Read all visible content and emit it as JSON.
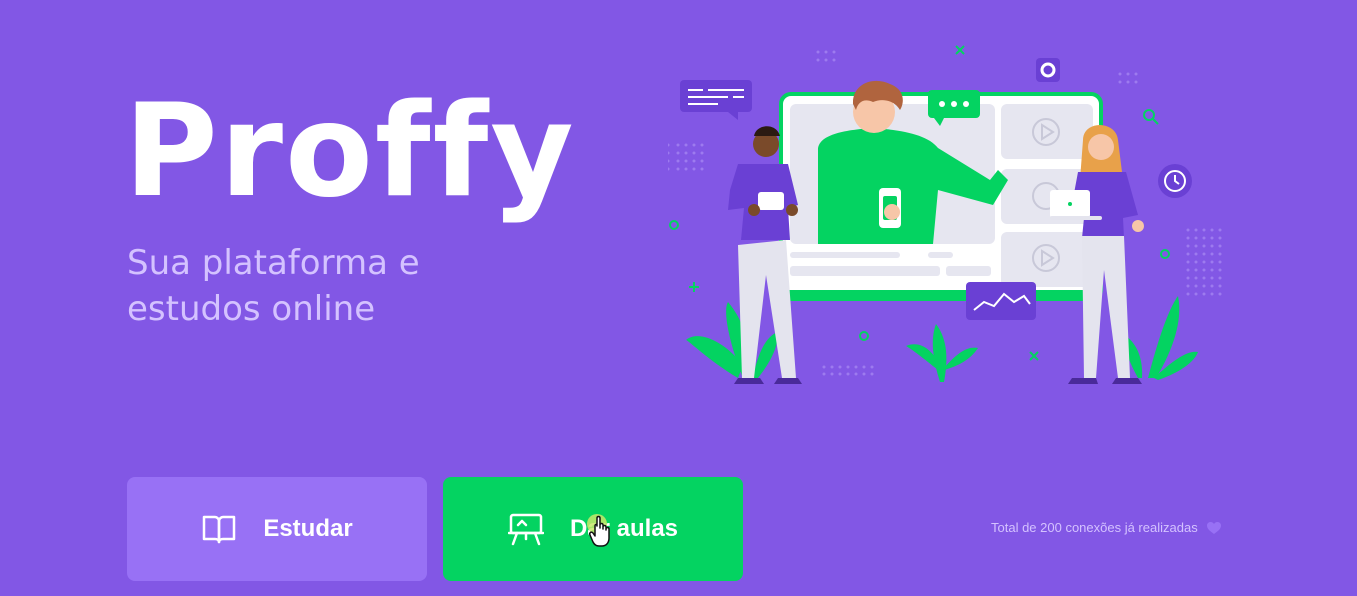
{
  "brand": {
    "logo_text": "Proffy",
    "tagline_line1": "Sua plataforma e",
    "tagline_line2": "estudos online"
  },
  "hero": {
    "illustration_icon": "online-class-illustration",
    "colors": {
      "accent_green": "#04D361",
      "primary_purple": "#8257E5"
    }
  },
  "actions": {
    "study": {
      "label": "Estudar",
      "icon": "book-open-icon",
      "color": "#9871F5"
    },
    "teach": {
      "label": "Dar aulas",
      "icon": "presentation-board-icon",
      "color": "#04D361"
    }
  },
  "footer": {
    "connections_text": "Total de 200 conexões já realizadas",
    "heart_icon": "purple-heart-icon"
  }
}
